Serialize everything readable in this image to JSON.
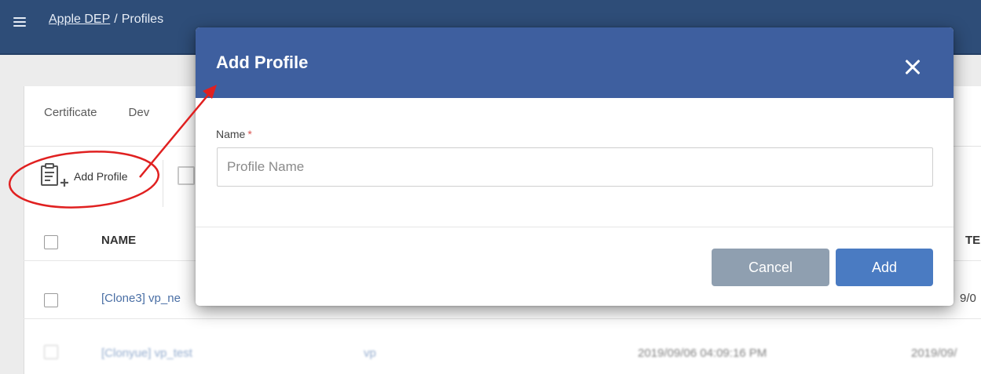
{
  "header": {
    "breadcrumb_link": "Apple DEP",
    "breadcrumb_separator": "/",
    "breadcrumb_current": "Profiles"
  },
  "tabs": [
    "Certificate",
    "Dev"
  ],
  "toolbar": {
    "add_profile_label": "Add Profile"
  },
  "table": {
    "columns": {
      "name": "NAME",
      "tail": "TED"
    },
    "rows": [
      {
        "name": "[Clone3] vp_ne",
        "tail": "9/0"
      },
      {
        "name": "[Clonyue] vp_test",
        "type": "vp",
        "created": "2019/09/06 04:09:16 PM",
        "tail": "2019/09/"
      }
    ]
  },
  "modal": {
    "title": "Add Profile",
    "field_label": "Name",
    "required_marker": "*",
    "name_placeholder": "Profile Name",
    "name_value": "",
    "cancel_label": "Cancel",
    "add_label": "Add"
  },
  "colors": {
    "topbar": "#2e4d78",
    "modal_header": "#3e5f9f",
    "add_button": "#4a7bc2",
    "cancel_button": "#8f9fb0",
    "annotation": "#e02020"
  },
  "icons": {
    "menu": "hamburger-icon",
    "add_profile": "clipboard-add-icon",
    "close": "close-icon"
  }
}
